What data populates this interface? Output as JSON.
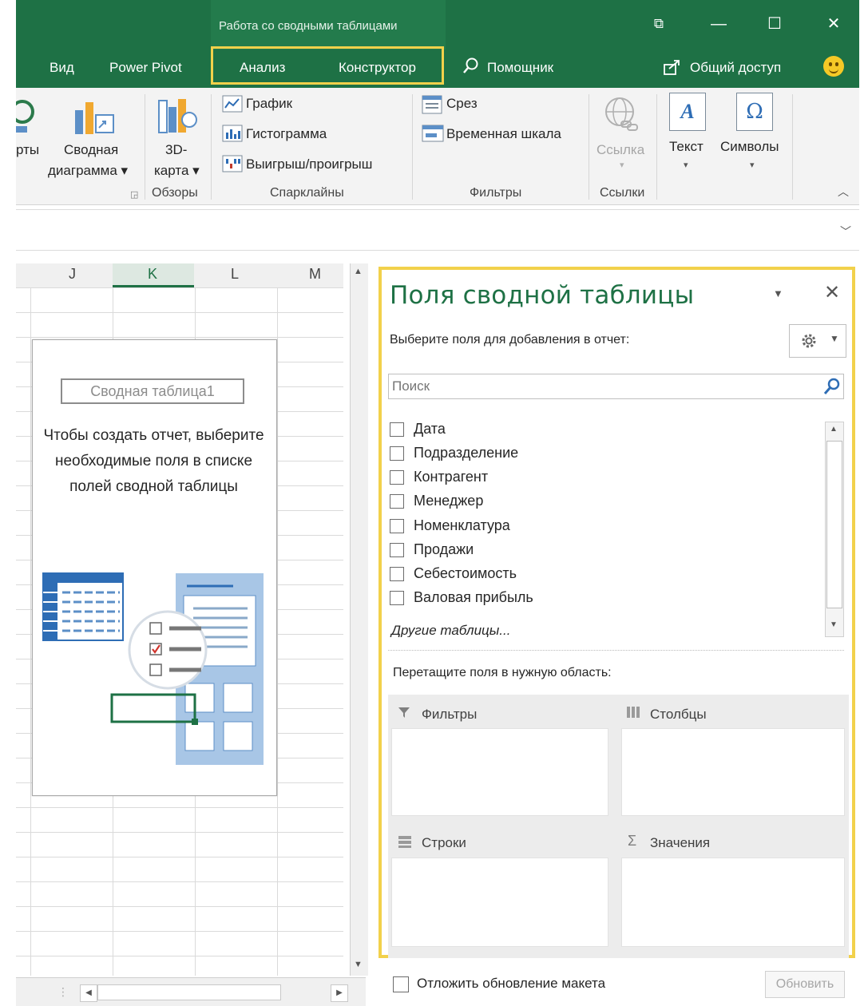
{
  "window": {
    "context_group_title": "Работа со сводными таблицами",
    "buttons": [
      "⧉",
      "—",
      "☐",
      "✕"
    ]
  },
  "tabs": {
    "view": "Вид",
    "power_pivot": "Power Pivot",
    "analyze": "Анализ",
    "design": "Конструктор",
    "tell_me": "Помощник",
    "share": "Общий доступ"
  },
  "ribbon": {
    "charts_partial": "рты",
    "pivot_chart": [
      "Сводная",
      "диаграмма ▾"
    ],
    "map_3d": [
      "3D-",
      "карта ▾"
    ],
    "group_tours": "Обзоры",
    "sparkline_line": "График",
    "sparkline_column": "Гистограмма",
    "sparkline_winloss": "Выигрыш/проигрыш",
    "group_sparklines": "Спарклайны",
    "slicer": "Срез",
    "timeline": "Временная шкала",
    "group_filters": "Фильтры",
    "link": "Ссылка",
    "group_links": "Ссылки",
    "text": "Текст",
    "symbols": "Символы"
  },
  "sheet": {
    "columns": [
      "J",
      "K",
      "L",
      "M"
    ],
    "selected_column": "K"
  },
  "placeholder": {
    "name": "Сводная таблица1",
    "message": "Чтобы создать отчет, выберите необходимые поля в списке полей сводной таблицы"
  },
  "pivot_pane": {
    "title": "Поля сводной таблицы",
    "subtitle": "Выберите поля для добавления в отчет:",
    "search_placeholder": "Поиск",
    "fields": [
      "Дата",
      "Подразделение",
      "Контрагент",
      "Менеджер",
      "Номенклатура",
      "Продажи",
      "Себестоимость",
      "Валовая прибыль"
    ],
    "more_tables": "Другие таблицы...",
    "drop_heading": "Перетащите поля в нужную область:",
    "areas": {
      "filters": "Фильтры",
      "columns": "Столбцы",
      "rows": "Строки",
      "values": "Значения"
    },
    "defer_label": "Отложить обновление макета",
    "update_button": "Обновить"
  },
  "colors": {
    "excel_green": "#1e7145",
    "highlight_yellow": "#f2d14b"
  }
}
